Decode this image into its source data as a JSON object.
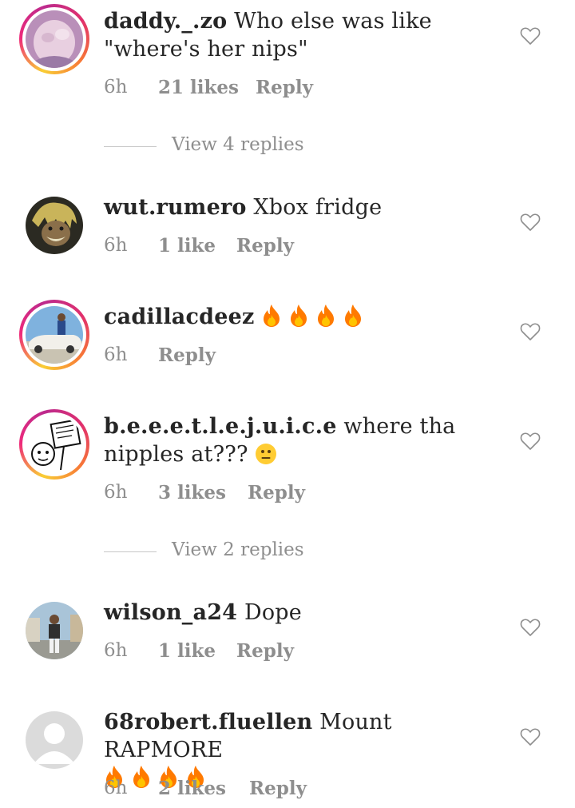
{
  "comments": [
    {
      "username": "daddy._.zo",
      "text": "Who else was like \"where's her nips\"",
      "time": "6h",
      "likes": "21 likes",
      "reply": "Reply",
      "view_replies": "View 4 replies",
      "avatar_ring": true
    },
    {
      "username": "wut.rumero",
      "text": "Xbox fridge",
      "time": "6h",
      "likes": "1 like",
      "reply": "Reply",
      "avatar_ring": false
    },
    {
      "username": "cadillacdeez",
      "text": "",
      "emoji": [
        "fire-emoji",
        "fire-emoji",
        "fire-emoji",
        "fire-emoji"
      ],
      "time": "6h",
      "reply": "Reply",
      "avatar_ring": true
    },
    {
      "username": "b.e.e.e.t.l.e.j.u.i.c.e",
      "text": "where tha nipples at???",
      "emoji": [
        "neutral-face-emoji"
      ],
      "time": "6h",
      "likes": "3 likes",
      "reply": "Reply",
      "view_replies": "View 2 replies",
      "avatar_ring": true
    },
    {
      "username": "wilson_a24",
      "text": "Dope",
      "time": "6h",
      "likes": "1 like",
      "reply": "Reply",
      "avatar_ring": false
    },
    {
      "username": "68robert.fluellen",
      "text": "Mount RAPMORE",
      "emoji": [
        "fire-emoji",
        "fire-emoji",
        "fire-emoji",
        "fire-emoji"
      ],
      "time": "6h",
      "likes": "2 likes",
      "reply": "Reply",
      "avatar_ring": false
    }
  ],
  "colors": {
    "text": "#262626",
    "secondary": "#8e8e8e",
    "divider": "#c7c7c7",
    "story_ring": [
      "#f9ce34",
      "#ee2a7b",
      "#bc2a8d"
    ]
  },
  "icons": {
    "like": "heart-outline-icon",
    "default_avatar": "default-avatar-icon"
  }
}
